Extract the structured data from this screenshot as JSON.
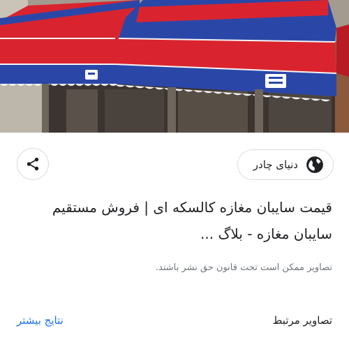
{
  "image": {
    "alt": "سایبان مغازه کالسکه ای قرمز و آبی",
    "colors": {
      "red": "#d9242f",
      "blue": "#2a47a8",
      "white_stripe": "#f4f4f4",
      "wall": "#9a9389"
    }
  },
  "share": {
    "icon": "share-icon"
  },
  "source": {
    "name": "دنیای چادر",
    "icon": "globe-icon"
  },
  "result": {
    "title": "قیمت سایبان مغازه کالسکه ای | فروش مستقیم سایبان مغازه - بلاگ ...",
    "notice": "تصاویر ممکن است تحت قانون حق نشر باشند."
  },
  "footer": {
    "related_label": "تصاویر مرتبط",
    "more_label": "نتایج بیشتر"
  },
  "colors": {
    "link": "#1a73e8",
    "secondary_text": "#70757a",
    "border": "#dadce0"
  }
}
